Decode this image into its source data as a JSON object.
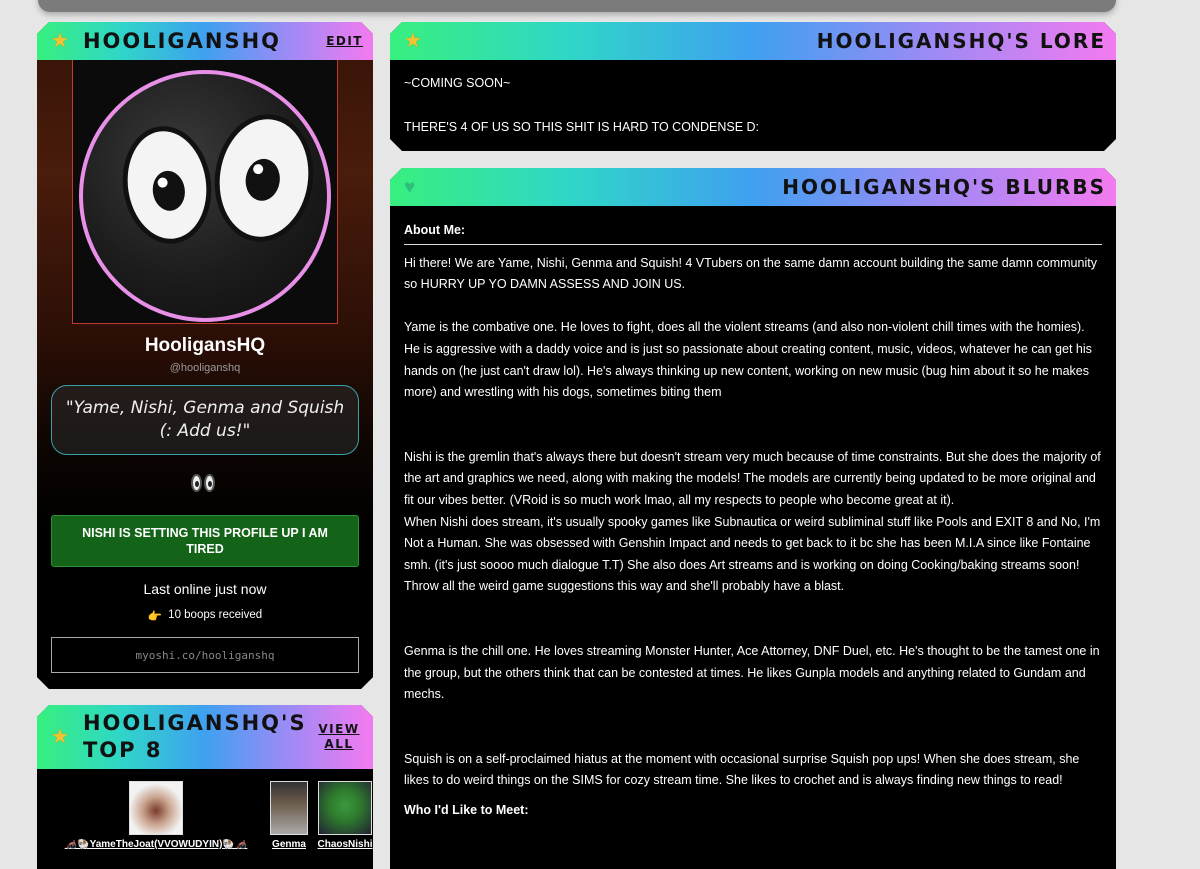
{
  "profile": {
    "header_title": "HOOLIGANSHQ",
    "edit_label": "EDIT",
    "display_name": "HooligansHQ",
    "handle": "@hooliganshq",
    "quote": "\"Yame, Nishi, Genma and Squish (: Add us!\"",
    "status": "NISHI IS SETTING THIS PROFILE UP I AM TIRED",
    "last_online": "Last online just now",
    "boops_icon": "👉",
    "boops": "10 boops received",
    "profile_url": "myoshi.co/hooliganshq"
  },
  "top8": {
    "title": "HOOLIGANSHQ'S TOP 8",
    "view_all": "VIEW ALL",
    "friends": [
      {
        "name": "🦽🐏YameTheJoat(VVOWUDYIN)🐏🦽"
      },
      {
        "name": "Genma"
      },
      {
        "name": "ChaosNishi"
      }
    ]
  },
  "lore": {
    "title": "HOOLIGANSHQ'S LORE",
    "line1": "~COMING SOON~",
    "line2": "THERE'S 4 OF US SO THIS SHIT IS HARD TO CONDENSE D:"
  },
  "blurbs": {
    "title": "HOOLIGANSHQ'S BLURBS",
    "about_heading": "About Me:",
    "intro": "Hi there! We are Yame, Nishi, Genma and Squish! 4 VTubers on the same damn account building the same damn community so HURRY UP YO DAMN ASSESS AND JOIN US.",
    "yame": "Yame is the combative one. He loves to fight, does all the violent streams (and also non-violent chill times with the homies). He is aggressive with a daddy voice and is just so passionate about creating content, music, videos, whatever he can get his hands on (he just can't draw lol). He's always thinking up new content, working on new music (bug him about it so he makes more) and wrestling with his dogs, sometimes biting them",
    "nishi1": "Nishi is the gremlin that's always there but doesn't stream very much because of time constraints. But she does the majority of the art and graphics we need, along with making the models! The models are currently being updated to be more original and fit our vibes better. (VRoid is so much work lmao, all my respects to people who become great at it).",
    "nishi2": "When Nishi does stream, it's usually spooky games like Subnautica or weird subliminal stuff like Pools and EXIT 8 and No, I'm Not a Human. She was obsessed with Genshin Impact and needs to get back to it bc she has been M.I.A since like Fontaine smh. (it's just soooo much dialogue T.T) She also does Art streams and is working on doing Cooking/baking streams soon! Throw all the weird game suggestions this way and she'll probably have a blast.",
    "genma": "Genma is the chill one. He loves streaming Monster Hunter, Ace Attorney, DNF Duel, etc. He's thought to be the tamest one in the group, but the others think that can be contested at times. He likes Gunpla models and anything related to Gundam and mechs.",
    "squish": "Squish is on a self-proclaimed hiatus at the moment with occasional surprise Squish pop ups! When she does stream, she likes to do weird things on the SIMS for cozy stream time. She likes to crochet and is always finding new things to read!",
    "meet_heading": "Who I'd Like to Meet:"
  },
  "icons": {
    "star": "star-icon",
    "heart": "green-heart-icon",
    "avatar": "googly-eyes-avatar"
  },
  "colors": {
    "header_gradient": [
      "#37f07e",
      "#2fd6c8",
      "#3fa0f0",
      "#9e8af5",
      "#f47af0"
    ],
    "status_bg": "#136318",
    "quote_border": "#3aa0a8"
  }
}
